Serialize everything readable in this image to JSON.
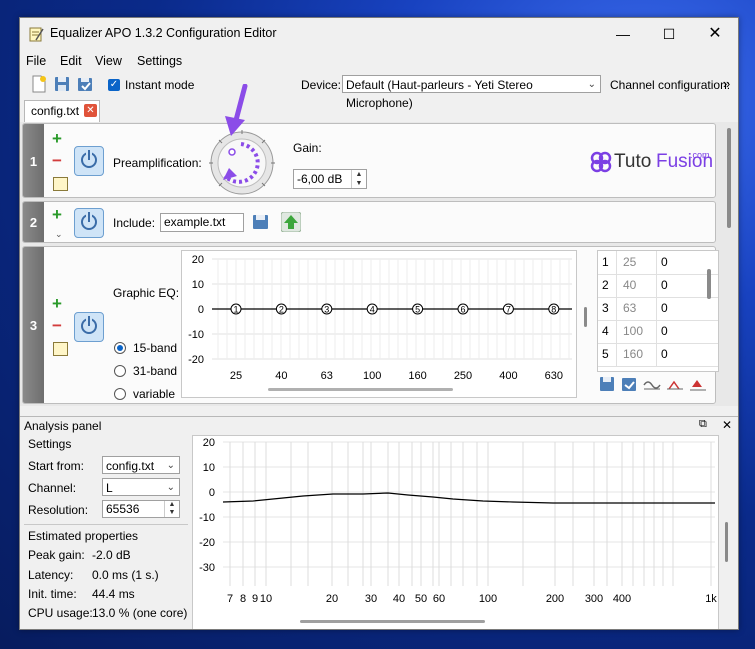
{
  "window": {
    "title": "Equalizer APO 1.3.2 Configuration Editor"
  },
  "menu": [
    "File",
    "Edit",
    "View",
    "Settings"
  ],
  "toolbar": {
    "instant_mode_label": "Instant mode",
    "device_label": "Device:",
    "device_value": "Default (Haut-parleurs - Yeti Stereo Microphone)",
    "channel_config_label": "Channel configuration:"
  },
  "tab": {
    "label": "config.txt"
  },
  "rows": [
    {
      "number": "1",
      "label": "Preamplification:",
      "gain_label": "Gain:",
      "gain_value": "-6,00 dB"
    },
    {
      "number": "2",
      "label": "Include:",
      "file_value": "example.txt"
    },
    {
      "number": "3",
      "label": "Graphic EQ:",
      "modes": [
        "15-band",
        "31-band",
        "variable"
      ],
      "selected_mode": "15-band",
      "y_ticks": [
        "20",
        "10",
        "0",
        "-10",
        "-20"
      ],
      "x_ticks": [
        "25",
        "40",
        "63",
        "100",
        "160",
        "250",
        "400",
        "630"
      ],
      "nodes": [
        "1",
        "2",
        "3",
        "4",
        "5",
        "6",
        "7",
        "8"
      ],
      "table": [
        {
          "index": "1",
          "freq": "25",
          "gain": "0"
        },
        {
          "index": "2",
          "freq": "40",
          "gain": "0"
        },
        {
          "index": "3",
          "freq": "63",
          "gain": "0"
        },
        {
          "index": "4",
          "freq": "100",
          "gain": "0"
        },
        {
          "index": "5",
          "freq": "160",
          "gain": "0"
        }
      ]
    }
  ],
  "watermark": {
    "text_a": "Tuto",
    "text_b": "Fusion",
    "suffix": ".com"
  },
  "analysis": {
    "title": "Analysis panel",
    "settings_title": "Settings",
    "start_from_label": "Start from:",
    "start_from_value": "config.txt",
    "channel_label": "Channel:",
    "channel_value": "L",
    "resolution_label": "Resolution:",
    "resolution_value": "65536",
    "estimated_title": "Estimated properties",
    "peak_gain_label": "Peak gain:",
    "peak_gain_value": "-2.0 dB",
    "latency_label": "Latency:",
    "latency_value": "0.0 ms (1 s.)",
    "init_time_label": "Init. time:",
    "init_time_value": "44.4 ms",
    "cpu_label": "CPU usage:",
    "cpu_value": "13.0 % (one core)",
    "y_ticks": [
      "20",
      "10",
      "0",
      "-10",
      "-20",
      "-30"
    ],
    "x_ticks": [
      "7",
      "8",
      "9",
      "10",
      "20",
      "30",
      "40",
      "50",
      "60",
      "100",
      "200",
      "300",
      "400",
      "1k"
    ]
  },
  "colors": {
    "accent": "#0a64c8",
    "annotation": "#8b4ce8",
    "watermark": "#7b3fe4"
  }
}
